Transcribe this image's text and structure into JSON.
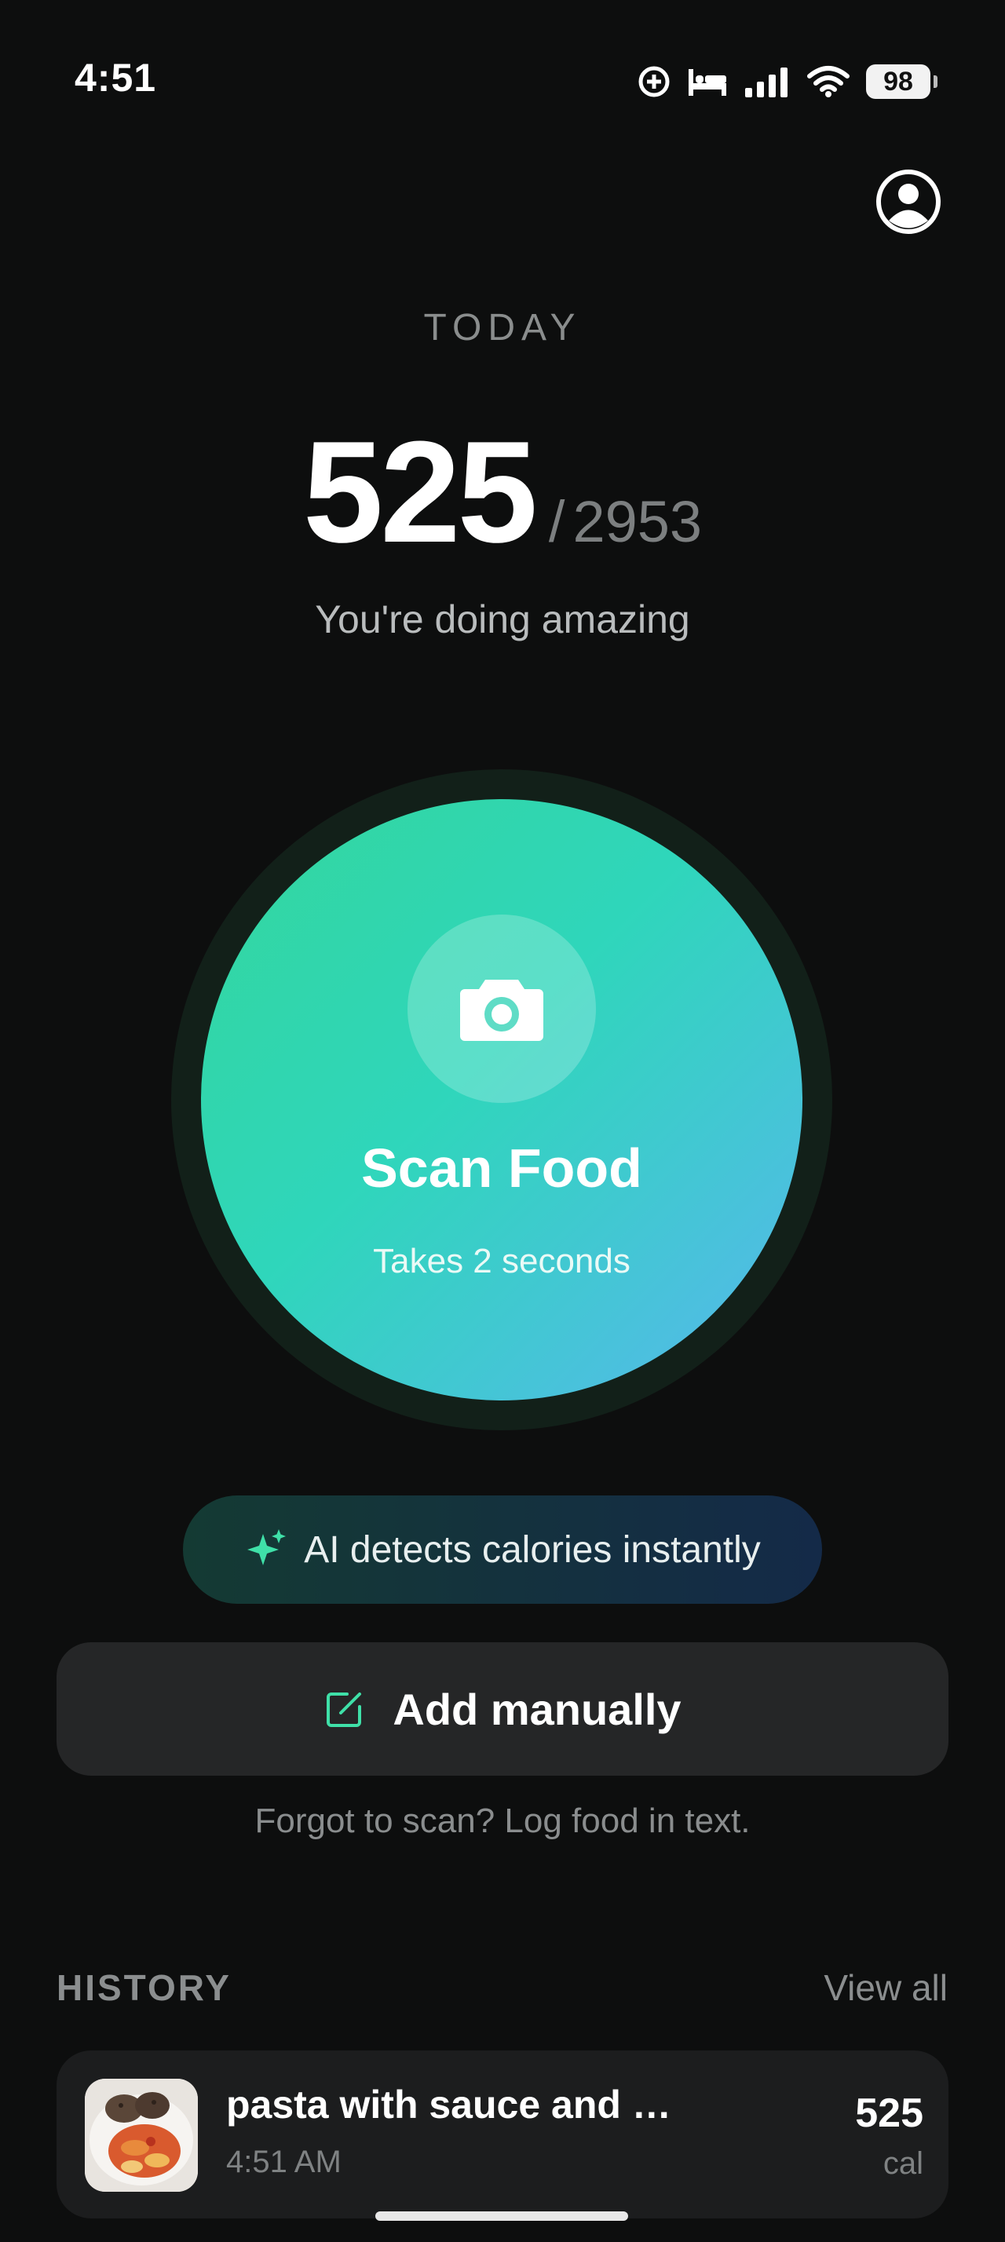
{
  "status_bar": {
    "time": "4:51",
    "battery": "98",
    "icons": [
      "focus-icon",
      "sleep-bed-icon",
      "signal-icon",
      "wifi-icon",
      "battery-icon"
    ]
  },
  "header": {
    "profile_icon": "account-circle-icon"
  },
  "summary": {
    "today_label": "TODAY",
    "calories_current": "525",
    "separator": "/",
    "calories_goal": "2953",
    "encouragement": "You're doing amazing"
  },
  "scan": {
    "title": "Scan Food",
    "subtitle": "Takes 2 seconds",
    "icon": "camera-icon",
    "gradient": [
      "#33d79c",
      "#2fd6bb",
      "#58b6ee"
    ]
  },
  "ai_pill": {
    "text": "AI detects calories instantly",
    "icon": "sparkle-icon",
    "accent": "#3fe0a8"
  },
  "manual": {
    "label": "Add manually",
    "icon": "edit-note-icon",
    "hint": "Forgot to scan? Log food in text."
  },
  "history": {
    "title": "HISTORY",
    "view_all": "View all",
    "items": [
      {
        "name": "pasta with sauce and meat patti…",
        "time": "4:51 AM",
        "calories": "525",
        "unit": "cal"
      }
    ]
  },
  "colors": {
    "background": "#0d0e0e",
    "accent": "#3fe0a8",
    "card": "#252627"
  }
}
